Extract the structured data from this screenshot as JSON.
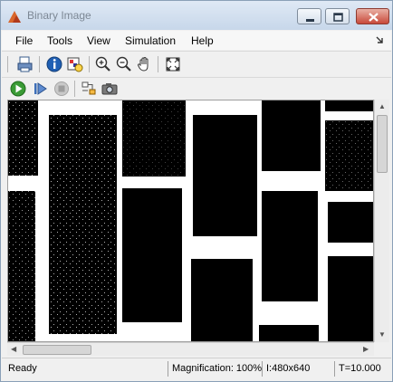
{
  "window": {
    "title": "Binary Image"
  },
  "menu": {
    "items": [
      "File",
      "Tools",
      "View",
      "Simulation",
      "Help"
    ]
  },
  "toolbar_primary": {
    "buttons": [
      "print-icon",
      "info-icon",
      "image-info-icon",
      "zoom-in-icon",
      "zoom-out-icon",
      "pan-hand-icon",
      "fit-to-view-icon"
    ]
  },
  "toolbar_simulation": {
    "buttons": [
      "run-icon",
      "step-forward-icon",
      "stop-icon",
      "highlight-model-icon",
      "snapshot-camera-icon"
    ]
  },
  "status": {
    "text": "Ready",
    "magnification": "Magnification: 100%",
    "size": "I:480x640",
    "time": "T=10.000"
  },
  "colors": {
    "background": "#f0f0f0",
    "image_foreground": "#ffffff",
    "image_background": "#000000",
    "run_green": "#3a9b35",
    "close_red": "#c8493a"
  }
}
